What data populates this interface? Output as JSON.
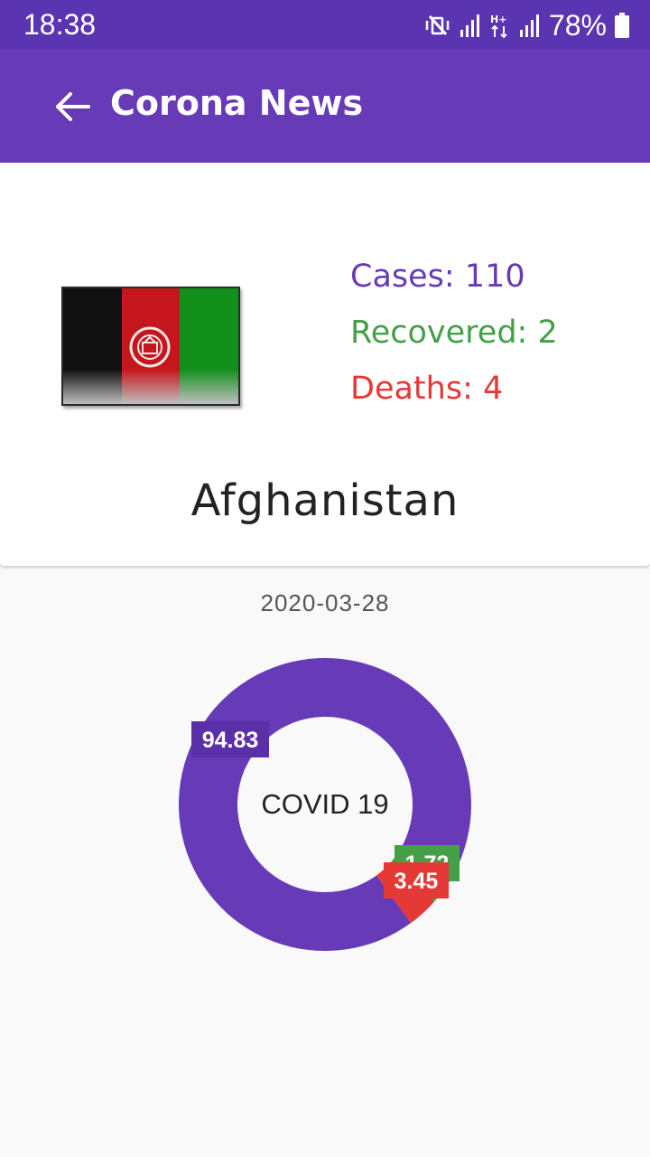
{
  "status_bar": {
    "time": "18:38",
    "battery": "78%",
    "icons": [
      "mute-vibrate-icon",
      "signal-icon",
      "hplus-data-icon",
      "signal-icon",
      "battery-icon"
    ]
  },
  "app_bar": {
    "title": "Corona News",
    "back_icon": "arrow-left-icon"
  },
  "country_card": {
    "stats": {
      "cases": "Cases: 110",
      "recovered": "Recovered: 2",
      "deaths": "Deaths: 4"
    },
    "country_name": "Afghanistan",
    "flag": {
      "stripes": [
        "#111111",
        "#c4161c",
        "#12901b"
      ]
    }
  },
  "date": "2020-03-28",
  "colors": {
    "primary": "#673ab7",
    "primary_dark": "#5b35b1",
    "recovered": "#43a047",
    "deaths": "#e53935"
  },
  "chart_data": {
    "type": "pie",
    "center_label": "COVID 19",
    "slices": [
      {
        "label": "94.83",
        "value": 94.83,
        "color": "#673ab7"
      },
      {
        "label": "1.72",
        "value": 1.72,
        "color": "#43a047"
      },
      {
        "label": "3.45",
        "value": 3.45,
        "color": "#e53935"
      }
    ]
  }
}
